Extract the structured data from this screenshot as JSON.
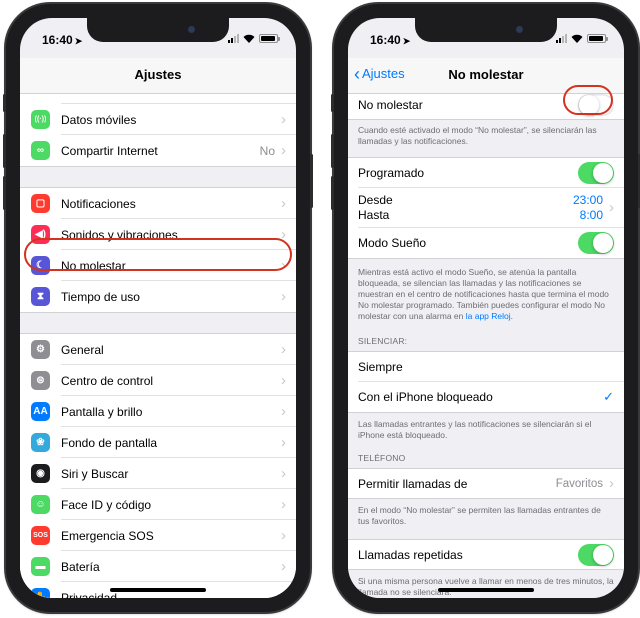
{
  "left_phone": {
    "status": {
      "time": "16:40"
    },
    "nav": {
      "title": "Ajustes"
    },
    "group1": [
      {
        "label": "Datos móviles",
        "icon": "antenna-icon",
        "color": "#4cd964",
        "glyph": "((·))"
      },
      {
        "label": "Compartir Internet",
        "icon": "chain-link-icon",
        "color": "#4cd964",
        "glyph": "∞",
        "value": "No"
      }
    ],
    "group2": [
      {
        "label": "Notificaciones",
        "icon": "notifications-icon",
        "color": "#ff3b30",
        "glyph": "▢"
      },
      {
        "label": "Sonidos y vibraciones",
        "icon": "speaker-icon",
        "color": "#ff2d55",
        "glyph": "◀)"
      },
      {
        "label": "No molestar",
        "icon": "moon-icon",
        "color": "#5856d6",
        "glyph": "☾"
      },
      {
        "label": "Tiempo de uso",
        "icon": "hourglass-icon",
        "color": "#5856d6",
        "glyph": "⧗"
      }
    ],
    "group3": [
      {
        "label": "General",
        "icon": "gear-icon",
        "color": "#8e8e93",
        "glyph": "⚙"
      },
      {
        "label": "Centro de control",
        "icon": "switches-icon",
        "color": "#8e8e93",
        "glyph": "⊜"
      },
      {
        "label": "Pantalla y brillo",
        "icon": "text-size-icon",
        "color": "#007aff",
        "glyph": "AA"
      },
      {
        "label": "Fondo de pantalla",
        "icon": "flower-icon",
        "color": "#34aadc",
        "glyph": "❀"
      },
      {
        "label": "Siri y Buscar",
        "icon": "siri-icon",
        "color": "#1c1c1e",
        "glyph": "◉"
      },
      {
        "label": "Face ID y código",
        "icon": "face-id-icon",
        "color": "#4cd964",
        "glyph": "☺"
      },
      {
        "label": "Emergencia SOS",
        "icon": "sos-icon",
        "color": "#ff3b30",
        "glyph": "SOS"
      },
      {
        "label": "Batería",
        "icon": "battery-setting-icon",
        "color": "#4cd964",
        "glyph": "▬"
      },
      {
        "label": "Privacidad",
        "icon": "hand-icon",
        "color": "#007aff",
        "glyph": "✋"
      }
    ]
  },
  "right_phone": {
    "status": {
      "time": "16:40"
    },
    "nav": {
      "back_label": "Ajustes",
      "title": "No molestar"
    },
    "dnd": {
      "label": "No molestar",
      "state": "off"
    },
    "dnd_footnote": "Cuando esté activado el modo “No molestar”, se silenciarán las llamadas y las notificaciones.",
    "scheduled": {
      "label": "Programado",
      "state": "on"
    },
    "from_to": {
      "from_label": "Desde",
      "to_label": "Hasta",
      "from_value": "23:00",
      "to_value": "8:00"
    },
    "sleep": {
      "label": "Modo Sueño",
      "state": "on"
    },
    "sleep_footnote": "Mientras está activo el modo Sueño, se atenúa la pantalla bloqueada, se silencian las llamadas y las notificaciones se muestran en el centro de notificaciones hasta que termina el modo No molestar programado. También puedes configurar el modo No molestar con una alarma en",
    "sleep_footnote_link": "la app Reloj.",
    "silence_header": "SILENCIAR:",
    "silence_options": [
      {
        "label": "Siempre",
        "selected": false
      },
      {
        "label": "Con el iPhone bloqueado",
        "selected": true
      }
    ],
    "silence_footnote": "Las llamadas entrantes y las notificaciones se silenciarán si el iPhone está bloqueado.",
    "phone_header": "TELÉFONO",
    "allow_calls": {
      "label": "Permitir llamadas de",
      "value": "Favoritos"
    },
    "allow_footnote": "En el modo “No molestar” se permiten las llamadas entrantes de tus favoritos.",
    "repeat": {
      "label": "Llamadas repetidas",
      "state": "on"
    },
    "repeat_footnote": "Si una misma persona vuelve a llamar en menos de tres minutos, la llamada no se silenciará."
  },
  "colors": {
    "accent": "#007aff",
    "toggle_on": "#4cd964",
    "highlight": "#d2321e"
  }
}
